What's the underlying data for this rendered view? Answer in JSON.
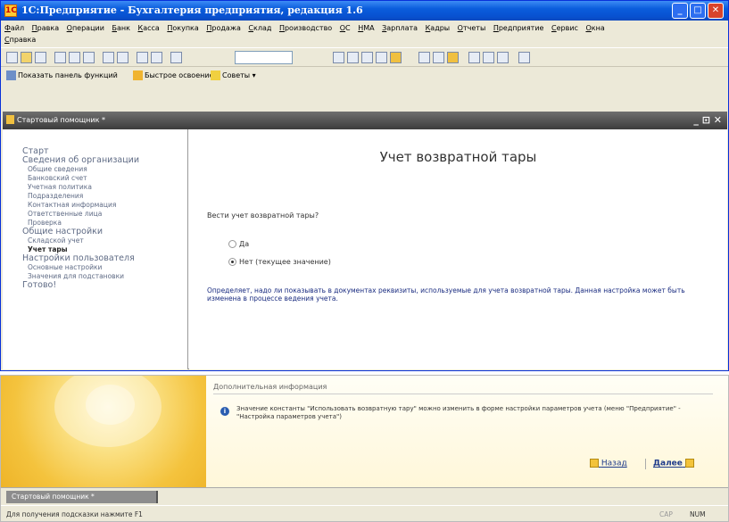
{
  "window": {
    "title": "1С:Предприятие - Бухгалтерия предприятия, редакция 1.6",
    "icon_text": "1С"
  },
  "menu": {
    "items": [
      "Файл",
      "Правка",
      "Операции",
      "Банк",
      "Касса",
      "Покупка",
      "Продажа",
      "Склад",
      "Производство",
      "ОС",
      "НМА",
      "Зарплата",
      "Кадры",
      "Отчеты",
      "Предприятие",
      "Сервис",
      "Окна",
      "Справка"
    ]
  },
  "toolbar2": {
    "show_panel": "Показать панель функций",
    "quick_start": "Быстрое освоение",
    "tips": "Советы"
  },
  "child_window": {
    "title": "Стартовый помощник *",
    "controls": "_ ⊡ ✕"
  },
  "nav": {
    "items": [
      {
        "label": "Старт",
        "level": 1
      },
      {
        "label": "Сведения об организации",
        "level": 1
      },
      {
        "label": "Общие сведения",
        "level": 2
      },
      {
        "label": "Банковский счет",
        "level": 2
      },
      {
        "label": "Учетная политика",
        "level": 2
      },
      {
        "label": "Подразделения",
        "level": 2
      },
      {
        "label": "Контактная информация",
        "level": 2
      },
      {
        "label": "Ответственные лица",
        "level": 2
      },
      {
        "label": "Проверка",
        "level": 2
      },
      {
        "label": "Общие настройки",
        "level": 1
      },
      {
        "label": "Складской учет",
        "level": 2
      },
      {
        "label": "Учет тары",
        "level": 2,
        "active": true
      },
      {
        "label": "Настройки пользователя",
        "level": 1
      },
      {
        "label": "Основные настройки",
        "level": 2
      },
      {
        "label": "Значения для подстановки",
        "level": 2
      },
      {
        "label": "Готово!",
        "level": 1
      }
    ]
  },
  "main": {
    "title": "Учет возвратной тары",
    "question": "Вести учет возвратной тары?",
    "option_yes": "Да",
    "option_no": "Нет (текущее значение)",
    "selected": "no",
    "description": "Определяет, надо ли показывать в документах реквизиты, используемые для учета возвратной тары. Данная настройка может быть изменена в процессе ведения учета."
  },
  "info": {
    "heading": "Дополнительная информация",
    "icon": "i",
    "text": "Значение константы \"Использовать возвратную тару\" можно изменить в форме настройки параметров учета (меню \"Предприятие\" - \"Настройка параметров учета\")"
  },
  "buttons": {
    "back": "Назад",
    "next": "Далее"
  },
  "taskbar": {
    "tab": "Стартовый помощник *"
  },
  "status": {
    "text": "Для получения подсказки нажмите F1",
    "cap": "CAP",
    "num": "NUM"
  },
  "colors": {
    "title_bar": "#0a5ddc",
    "nav_text": "#5f6b85",
    "description_text": "#1a2c80",
    "link": "#1d3a8a",
    "art": "#f4c33d"
  }
}
